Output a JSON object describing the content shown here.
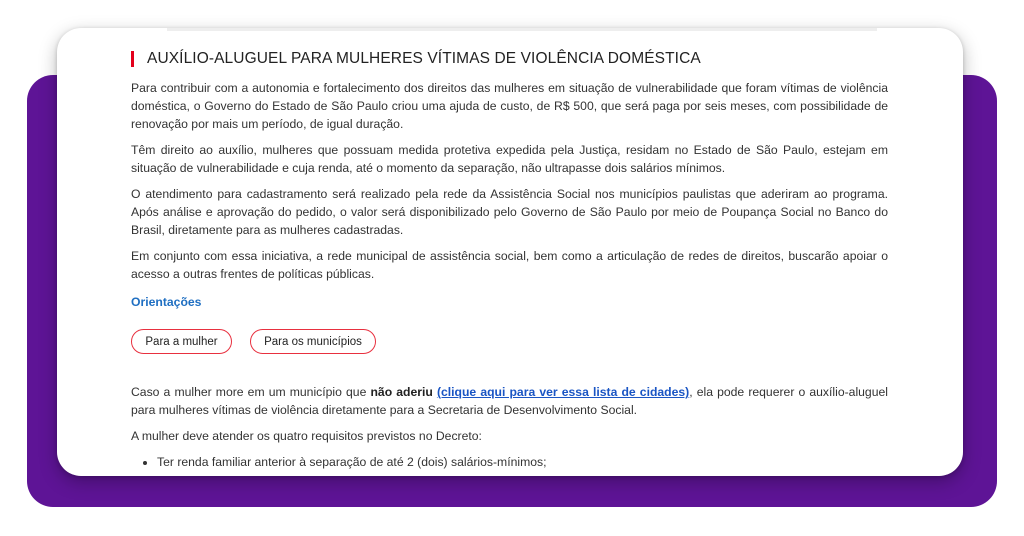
{
  "article": {
    "title": "AUXÍLIO-ALUGUEL PARA MULHERES VÍTIMAS DE VIOLÊNCIA DOMÉSTICA",
    "paragraphs": [
      "Para contribuir com a autonomia e fortalecimento dos direitos das mulheres em situação de vulnerabilidade que foram vítimas de violência doméstica, o Governo do Estado de São Paulo criou uma ajuda de custo, de R$ 500, que será paga por seis meses, com possibilidade de renovação por mais um período, de igual duração.",
      "Têm direito ao auxílio, mulheres que possuam medida protetiva expedida pela Justiça, residam no Estado de São Paulo, estejam em situação de vulnerabilidade e cuja renda, até o momento da separação, não ultrapasse dois salários mínimos.",
      "O atendimento para cadastramento será realizado pela rede da Assistência Social nos municípios paulistas que aderiram ao programa. Após análise e aprovação do pedido, o valor será disponibilizado pelo Governo de São Paulo por meio de Poupança Social no Banco do Brasil, diretamente para as mulheres cadastradas.",
      "Em conjunto com essa iniciativa, a rede municipal de assistência social, bem como a articulação de redes de direitos, buscarão apoiar o acesso a outras frentes de políticas públicas."
    ],
    "orientations_label": "Orientações",
    "buttons": {
      "woman": "Para a mulher",
      "municipalities": "Para os municípios"
    },
    "case_paragraph": {
      "before": "Caso a mulher more em um município que ",
      "bold": "não aderiu",
      "space": " ",
      "link": "(clique aqui para ver essa lista de cidades)",
      "after": ", ela pode requerer o auxílio-aluguel para mulheres vítimas de violência diretamente para a Secretaria de Desenvolvimento Social."
    },
    "requirements_intro": "A mulher deve atender os quatro requisitos previstos no Decreto:",
    "requirements": [
      "Ter renda familiar anterior à separação de até 2 (dois) salários-mínimos;"
    ]
  },
  "colors": {
    "frame": "#5e1496",
    "accent_red": "#e3001b",
    "link_blue": "#1f6fc2"
  }
}
